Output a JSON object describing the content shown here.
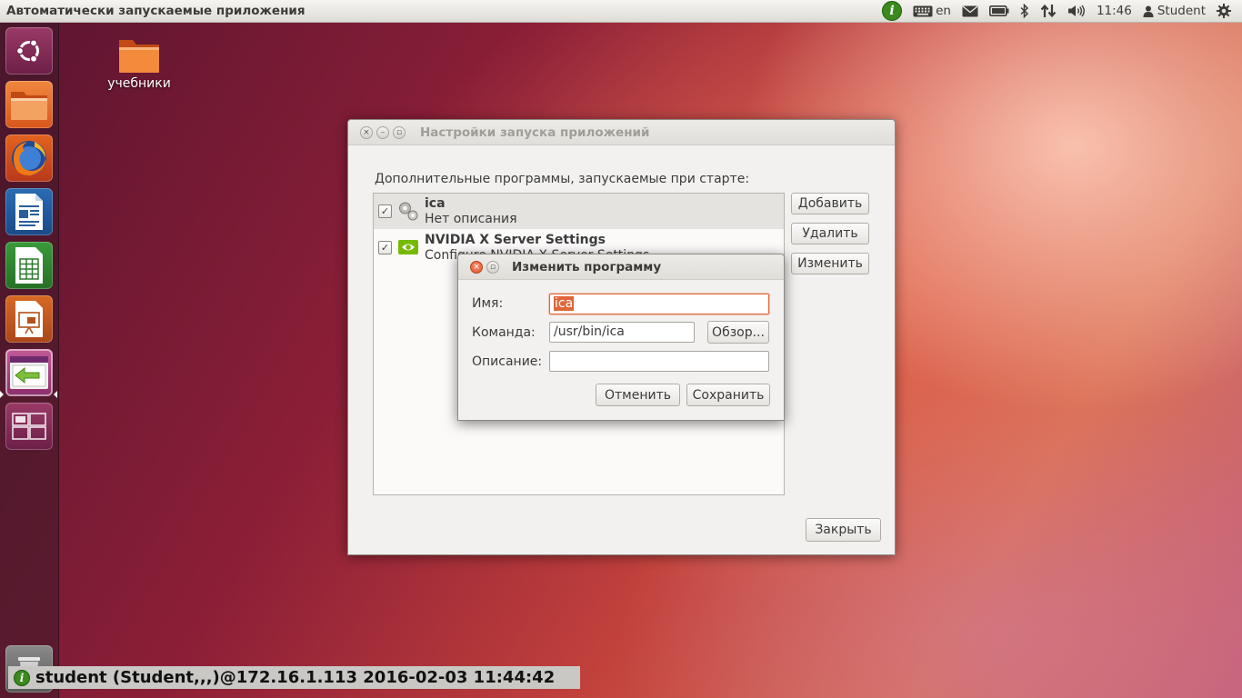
{
  "top_panel": {
    "app_title": "Автоматически запускаемые приложения",
    "keyboard_layout": "en",
    "time": "11:46",
    "user": "Student"
  },
  "launcher": {
    "items": [
      "ubuntu-dash",
      "files",
      "firefox",
      "libreoffice-writer",
      "libreoffice-calc",
      "libreoffice-impress",
      "startup-applications",
      "workspace-switcher",
      "trash"
    ]
  },
  "desktop": {
    "folder_label": "учебники"
  },
  "main_window": {
    "title": "Настройки запуска приложений",
    "section_label": "Дополнительные программы, запускаемые при старте:",
    "items": [
      {
        "name": "ica",
        "description": "Нет описания",
        "checked": true
      },
      {
        "name": "NVIDIA X Server Settings",
        "description": "Configure NVIDIA X Server Settings",
        "checked": true
      }
    ],
    "add_label": "Добавить",
    "remove_label": "Удалить",
    "edit_label": "Изменить",
    "close_label": "Закрыть"
  },
  "dialog": {
    "title": "Изменить программу",
    "name_label": "Имя:",
    "name_value": "ica",
    "command_label": "Команда:",
    "command_value": "/usr/bin/ica",
    "browse_label": "Обзор...",
    "description_label": "Описание:",
    "description_value": "",
    "cancel_label": "Отменить",
    "save_label": "Сохранить"
  },
  "status_bar": {
    "text": "student (Student,,,)@172.16.1.113 2016-02-03 11:44:42"
  },
  "colors": {
    "accent": "#e0663a",
    "info_green": "#3a8a1f"
  }
}
